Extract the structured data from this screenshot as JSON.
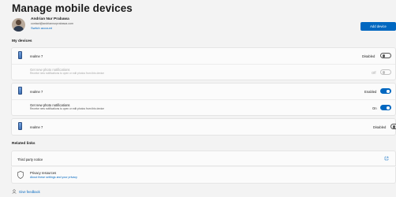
{
  "page": {
    "title": "Manage mobile devices"
  },
  "account": {
    "name": "Andrian Nur Prabawa",
    "email": "contact@andriannurprabawa.com",
    "switch_label": "Switch account"
  },
  "add_device_label": "Add device",
  "sections": {
    "my_devices": "My devices",
    "related_links": "Related links"
  },
  "devices": [
    {
      "name": "realme 7",
      "state_label": "Disabled",
      "enabled": false,
      "expanded": true,
      "notification": {
        "title": "Get new photo notifications",
        "description": "Receive new notifications to open or edit photos from this device",
        "state_label": "Off",
        "enabled": false,
        "disabled": true
      }
    },
    {
      "name": "realme 7",
      "state_label": "Enabled",
      "enabled": true,
      "expanded": true,
      "notification": {
        "title": "Get new photo notifications",
        "description": "Receive new notifications to open or edit photos from this device",
        "state_label": "On",
        "enabled": true,
        "disabled": false
      }
    },
    {
      "name": "realme 7",
      "state_label": "Disabled",
      "enabled": false,
      "expanded": false
    }
  ],
  "related_links": {
    "third_party": "Third party notice",
    "privacy_title": "Privacy resources",
    "privacy_link": "About these settings and your privacy"
  },
  "feedback_label": "Give feedback",
  "colors": {
    "accent": "#0067c0",
    "background": "#f3f3f3",
    "card": "#fbfbfb"
  }
}
